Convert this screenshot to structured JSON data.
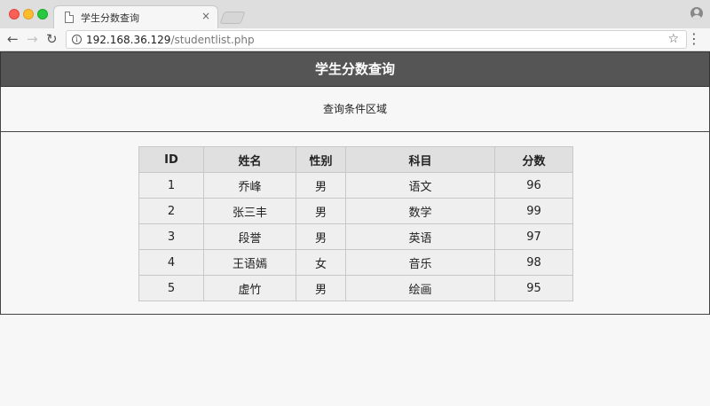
{
  "browser": {
    "tab_title": "学生分数查询",
    "tab_close": "×",
    "url_host": "192.168.36.129",
    "url_path": "/studentlist.php",
    "icons": {
      "back": "arrow-left-icon",
      "forward": "arrow-right-icon",
      "reload": "reload-icon",
      "info": "info-icon",
      "star": "star-icon",
      "menu": "menu-icon",
      "profile": "profile-icon"
    }
  },
  "page": {
    "title": "学生分数查询",
    "query_area_label": "查询条件区域",
    "colors": {
      "header_bg": "#555555",
      "header_text": "#ffffff"
    }
  },
  "table": {
    "headers": [
      "ID",
      "姓名",
      "性别",
      "科目",
      "分数"
    ],
    "rows": [
      [
        "1",
        "乔峰",
        "男",
        "语文",
        "96"
      ],
      [
        "2",
        "张三丰",
        "男",
        "数学",
        "99"
      ],
      [
        "3",
        "段誉",
        "男",
        "英语",
        "97"
      ],
      [
        "4",
        "王语嫣",
        "女",
        "音乐",
        "98"
      ],
      [
        "5",
        "虚竹",
        "男",
        "绘画",
        "95"
      ]
    ]
  }
}
